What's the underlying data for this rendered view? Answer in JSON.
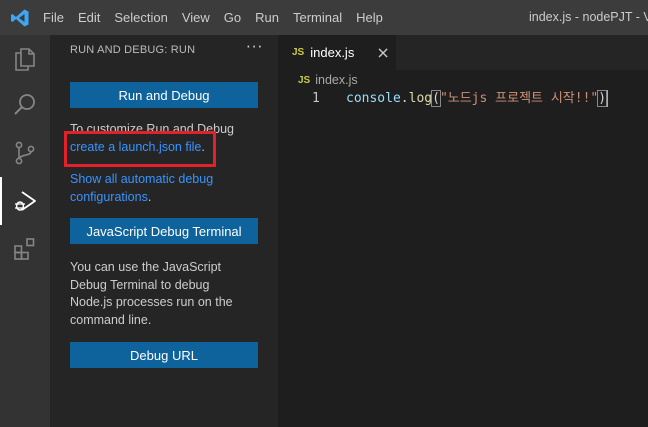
{
  "titlebar": {
    "menu": [
      "File",
      "Edit",
      "Selection",
      "View",
      "Go",
      "Run",
      "Terminal",
      "Help"
    ],
    "window_title": "index.js - nodePJT - Vis"
  },
  "activity_bar": {
    "items": [
      "explorer-icon",
      "search-icon",
      "source-control-icon",
      "run-debug-icon",
      "extensions-icon"
    ],
    "active": "run-debug-icon"
  },
  "sidebar": {
    "title": "RUN AND DEBUG: RUN",
    "more": "···",
    "run_debug_button": "Run and Debug",
    "customize_text": "To customize Run and Debug",
    "launch_link": "create a launch.json file",
    "launch_suffix": ".",
    "show_all_link_line1": "Show all automatic debug",
    "show_all_link_line2": "configurations",
    "show_all_suffix": ".",
    "js_debug_button": "JavaScript Debug Terminal",
    "info_text_lines": [
      "You can use the JavaScript",
      "Debug Terminal to debug",
      "Node.js processes run on the",
      "command line."
    ],
    "debug_url_button": "Debug URL"
  },
  "editor": {
    "tab": {
      "badge": "JS",
      "label": "index.js",
      "close": "×"
    },
    "breadcrumb": {
      "badge": "JS",
      "file": "index.js"
    },
    "lines": [
      {
        "number": "1",
        "tokens": {
          "object": "console",
          "dot": ".",
          "method": "log",
          "open": "(",
          "string": "\"노드js 프로젝트 시작!!\"",
          "close": ")"
        }
      }
    ]
  },
  "colors": {
    "accent": "#0e639c",
    "link": "#3794ff",
    "highlight": "#e3212a",
    "js_badge": "#cbcb41"
  }
}
